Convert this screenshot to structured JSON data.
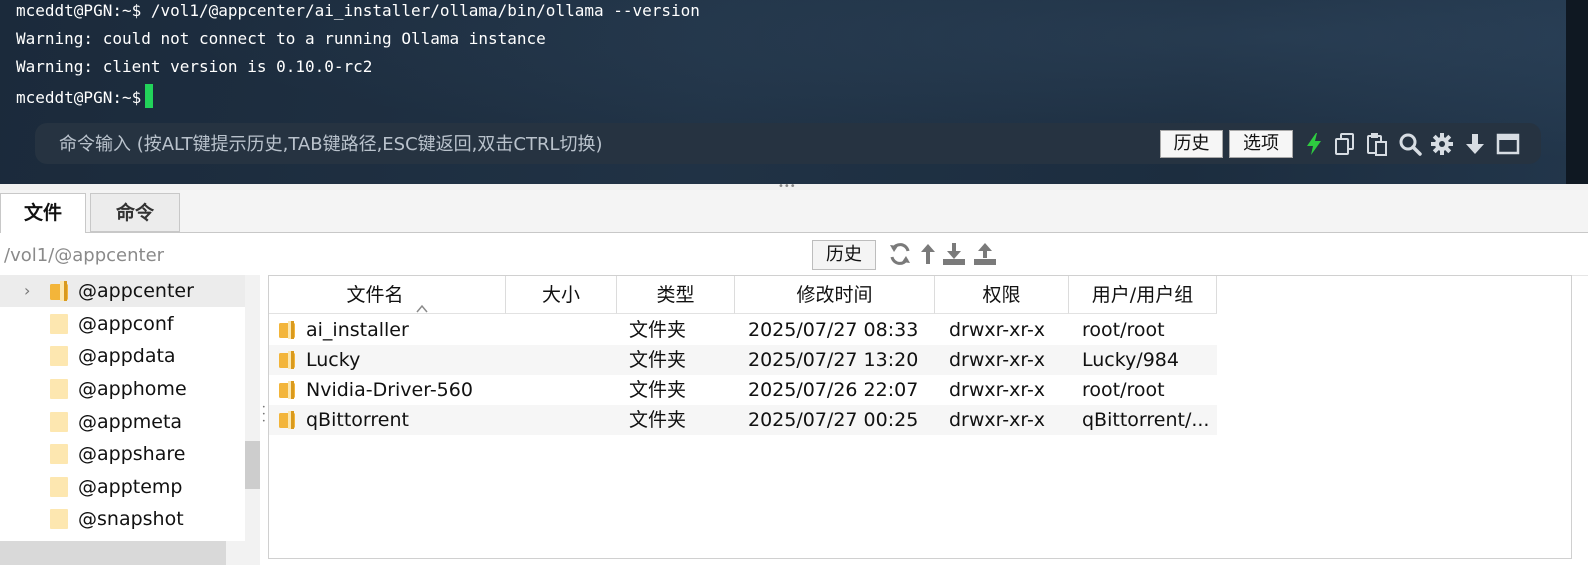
{
  "terminal": {
    "lines": [
      "mceddt@PGN:~$ /vol1/@appcenter/ai_installer/ollama/bin/ollama --version",
      "Warning: could not connect to a running Ollama instance",
      "Warning: client version is 0.10.0-rc2",
      "mceddt@PGN:~$"
    ],
    "cursor_color": "#22d35a",
    "command_bar": {
      "placeholder": "命令输入 (按ALT键提示历史,TAB键路径,ESC键返回,双击CTRL切换)",
      "history_label": "历史",
      "options_label": "选项",
      "icons": [
        "lightning-icon",
        "copy-icon",
        "paste-icon",
        "search-icon",
        "gear-icon",
        "arrow-down-icon",
        "window-icon"
      ]
    }
  },
  "tabs": [
    {
      "label": "文件",
      "active": true
    },
    {
      "label": "命令",
      "active": false
    }
  ],
  "pathbar": {
    "path": "/vol1/@appcenter",
    "history_label": "历史",
    "icons": [
      "refresh-icon",
      "up-icon",
      "download-icon",
      "upload-icon"
    ]
  },
  "tree": {
    "items": [
      {
        "label": "@appcenter",
        "selected": true,
        "expandable": true
      },
      {
        "label": "@appconf"
      },
      {
        "label": "@appdata"
      },
      {
        "label": "@apphome"
      },
      {
        "label": "@appmeta"
      },
      {
        "label": "@appshare"
      },
      {
        "label": "@apptemp"
      },
      {
        "label": "@snapshot"
      }
    ]
  },
  "file_list": {
    "columns": [
      "文件名",
      "大小",
      "类型",
      "修改时间",
      "权限",
      "用户/用户组"
    ],
    "sort_indicator": "^",
    "rows": [
      {
        "name": "ai_installer",
        "size": "",
        "type": "文件夹",
        "modified": "2025/07/27 08:33",
        "perm": "drwxr-xr-x",
        "owner": "root/root"
      },
      {
        "name": "Lucky",
        "size": "",
        "type": "文件夹",
        "modified": "2025/07/27 13:20",
        "perm": "drwxr-xr-x",
        "owner": "Lucky/984"
      },
      {
        "name": "Nvidia-Driver-560",
        "size": "",
        "type": "文件夹",
        "modified": "2025/07/26 22:07",
        "perm": "drwxr-xr-x",
        "owner": "root/root"
      },
      {
        "name": "qBittorrent",
        "size": "",
        "type": "文件夹",
        "modified": "2025/07/27 00:25",
        "perm": "drwxr-xr-x",
        "owner": "qBittorrent/..."
      }
    ]
  },
  "colors": {
    "folder": "#f3b53a",
    "terminal_bg": "#1e2f42",
    "accent_green": "#22d35a"
  }
}
